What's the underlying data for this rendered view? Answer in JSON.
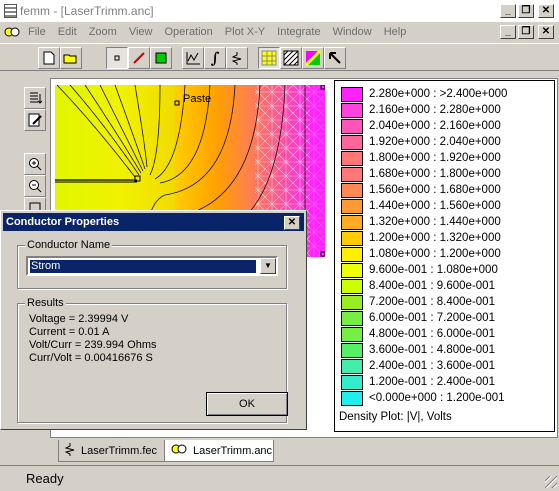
{
  "window": {
    "title": "femm - [LaserTrimm.anc]",
    "min_glyph": "_",
    "restore_glyph": "❐",
    "close_glyph": "✕"
  },
  "menu": [
    "File",
    "Edit",
    "Zoom",
    "View",
    "Operation",
    "Plot X-Y",
    "Integrate",
    "Window",
    "Help"
  ],
  "plot": {
    "label": "Paste"
  },
  "legend": {
    "colors": [
      "#ff22ff",
      "#ff44dd",
      "#ff55bb",
      "#ff6699",
      "#ff7777",
      "#ff8855",
      "#ff9933",
      "#ffaa22",
      "#ffcc00",
      "#ffee00",
      "#eeff00",
      "#ccff00",
      "#99ee22",
      "#77ee44",
      "#55ee66",
      "#44eeaa",
      "#33eecc",
      "#22eeee"
    ],
    "rows": [
      "2.280e+000 : >2.400e+000",
      "2.160e+000 : 2.280e+000",
      "2.040e+000 : 2.160e+000",
      "1.920e+000 : 2.040e+000",
      "1.800e+000 : 1.920e+000",
      "1.680e+000 : 1.800e+000",
      "1.560e+000 : 1.680e+000",
      "1.440e+000 : 1.560e+000",
      "1.320e+000 : 1.440e+000",
      "1.200e+000 : 1.320e+000",
      "1.080e+000 : 1.200e+000",
      "9.600e-001 : 1.080e+000",
      "8.400e-001 : 9.600e-001",
      "7.200e-001 : 8.400e-001",
      "6.000e-001 : 7.200e-001",
      "4.800e-001 : 6.000e-001",
      "3.600e-001 : 4.800e-001",
      "2.400e-001 : 3.600e-001",
      "1.200e-001 : 2.400e-001",
      "<0.000e+000 : 1.200e-001"
    ],
    "caption": "Density Plot: |V|, Volts"
  },
  "dialog": {
    "title": "Conductor Properties",
    "close_glyph": "✕",
    "name_group": "Conductor Name",
    "selected_conductor": "Strom",
    "dropdown_glyph": "▼",
    "results_group": "Results",
    "results": [
      "Voltage = 2.39994 V",
      "Current = 0.01 A",
      "Volt/Curr = 239.994 Ohms",
      "Curr/Volt = 0.00416676 S"
    ],
    "ok_label": "OK"
  },
  "tabs": [
    "LaserTrimm.fec",
    "LaserTrimm.anc"
  ],
  "status": "Ready"
}
